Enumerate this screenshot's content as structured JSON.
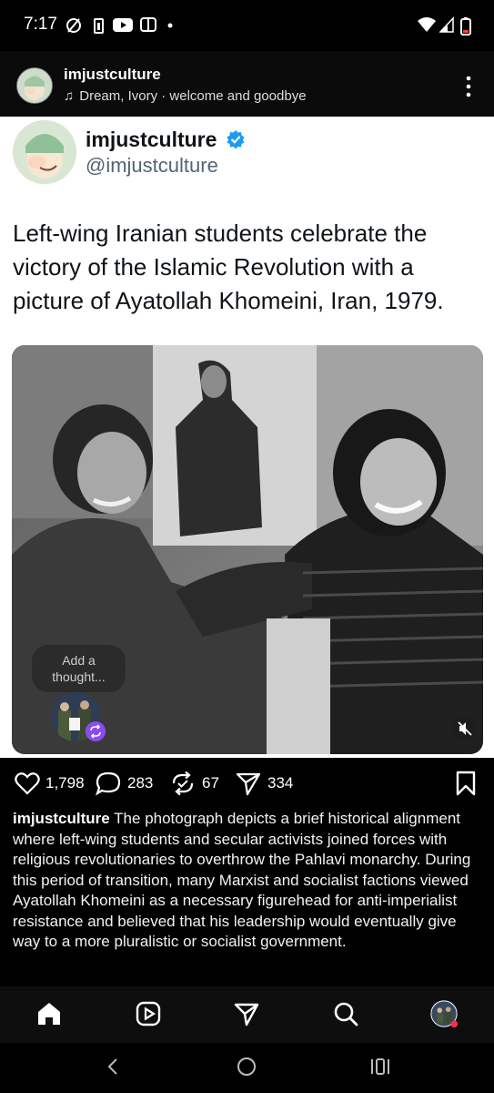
{
  "status_bar": {
    "time": "7:17"
  },
  "post_header": {
    "username": "imjustculture",
    "music": "Dream, Ivory · welcome and goodbye"
  },
  "tweet": {
    "display_name": "imjustculture",
    "handle": "@imjustculture",
    "text": "Left-wing Iranian students celebrate the victory of the Islamic Revolution with a picture of Ayatollah Khomeini, Iran, 1979."
  },
  "thought_bubble": {
    "label": "Add a thought..."
  },
  "actions": {
    "likes": "1,798",
    "comments": "283",
    "reposts": "67",
    "shares": "334"
  },
  "caption": {
    "username": "imjustculture",
    "text": "The photograph depicts a brief historical alignment where left-wing students and secular activists joined forces with religious revolutionaries to overthrow the Pahlavi monarchy. During this period of transition, many Marxist and socialist factions viewed Ayatollah Khomeini as a necessary figurehead for anti-imperialist resistance and believed that his leadership would eventually give way to a more pluralistic or socialist government."
  },
  "colors": {
    "verified_blue": "#1d9bf0",
    "repost_purple": "#8a4cf0",
    "notification_red": "#ff3040"
  },
  "icons": [
    "wifi-icon",
    "signal-icon",
    "battery-icon",
    "heart-icon",
    "comment-icon",
    "repost-icon",
    "share-icon",
    "bookmark-icon",
    "home-icon",
    "reels-icon",
    "send-icon",
    "search-icon",
    "mute-icon"
  ]
}
